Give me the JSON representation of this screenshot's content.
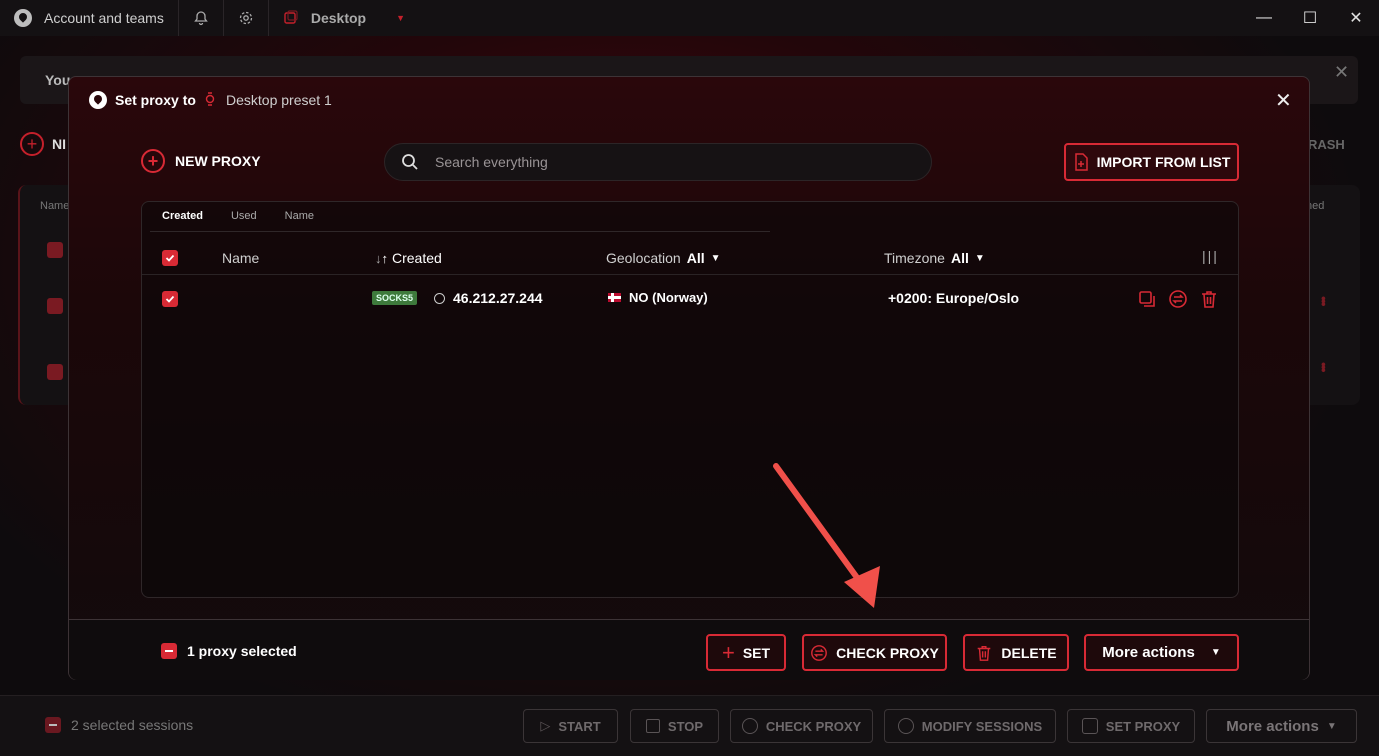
{
  "titlebar": {
    "account_label": "Account and teams",
    "workspace_label": "Desktop",
    "window_controls": [
      "—",
      "☐",
      "✕"
    ]
  },
  "background": {
    "banner_text": "You",
    "new_label": "NI",
    "trash_label": "TRASH",
    "col_name": "Name",
    "col_right": "ned",
    "bottom": {
      "selected_text": "2 selected sessions",
      "buttons": {
        "start": "START",
        "stop": "STOP",
        "check_proxy": "CHECK PROXY",
        "modify_sessions": "MODIFY SESSIONS",
        "set_proxy": "SET PROXY",
        "more_actions": "More actions"
      }
    }
  },
  "modal": {
    "title": "Set proxy to",
    "preset": "Desktop preset 1",
    "new_proxy_label": "NEW PROXY",
    "search_placeholder": "Search everything",
    "import_label": "IMPORT FROM LIST",
    "sort_tabs": [
      "Created",
      "Used",
      "Name"
    ],
    "columns": {
      "name": "Name",
      "created": "Created",
      "geolocation": "Geolocation",
      "geolocation_filter": "All",
      "timezone": "Timezone",
      "timezone_filter": "All"
    },
    "rows": [
      {
        "type": "SOCKS5",
        "ip": "46.212.27.244",
        "geo": "NO (Norway)",
        "timezone": "+0200: Europe/Oslo"
      }
    ],
    "footer": {
      "selected_text": "1 proxy selected",
      "set_label": "SET",
      "check_label": "CHECK PROXY",
      "delete_label": "DELETE",
      "more_label": "More actions"
    }
  },
  "colors": {
    "accent": "#d82a35",
    "socks_badge": "#3e7a3c"
  }
}
